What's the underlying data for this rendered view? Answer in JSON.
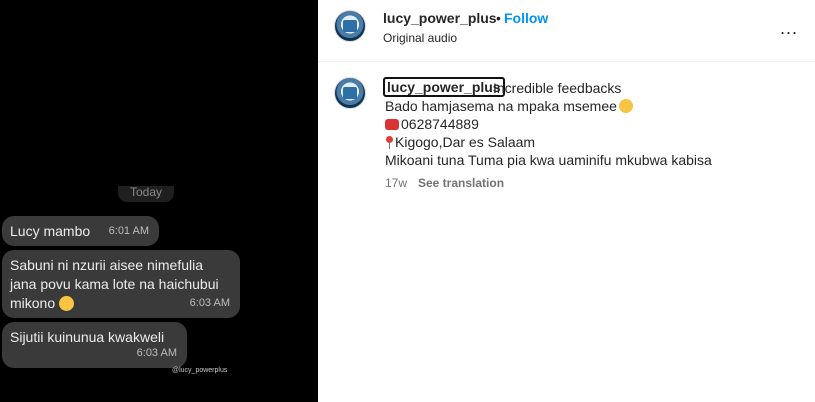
{
  "media": {
    "date_separator": "Today",
    "messages": [
      {
        "text": "Lucy mambo",
        "time": "6:01 AM"
      },
      {
        "text": "Sabuni ni nzurii aisee nimefulia jana povu kama lote na haichubui mikono",
        "time": "6:03 AM",
        "emoji": "hugging-face-emoji"
      },
      {
        "text": "Sijutii kuinunua kwakweli",
        "time": "6:03 AM"
      }
    ],
    "watermark": "@lucy_powerplus"
  },
  "header": {
    "username": "lucy_power_plus",
    "separator": "•",
    "follow_label": "Follow",
    "audio_label": "Original audio",
    "more_label": "..."
  },
  "caption": {
    "username": "lucy_power_plus",
    "line0": "Incredible feedbacks",
    "line1": "Bado hamjasema na mpaka msemee",
    "line2": "0628744889",
    "line3": "Kigogo,Dar es Salaam",
    "line4": "Mikoani tuna Tuma pia kwa uaminifu mkubwa kabisa",
    "time": "17w",
    "see_translation": "See translation"
  }
}
